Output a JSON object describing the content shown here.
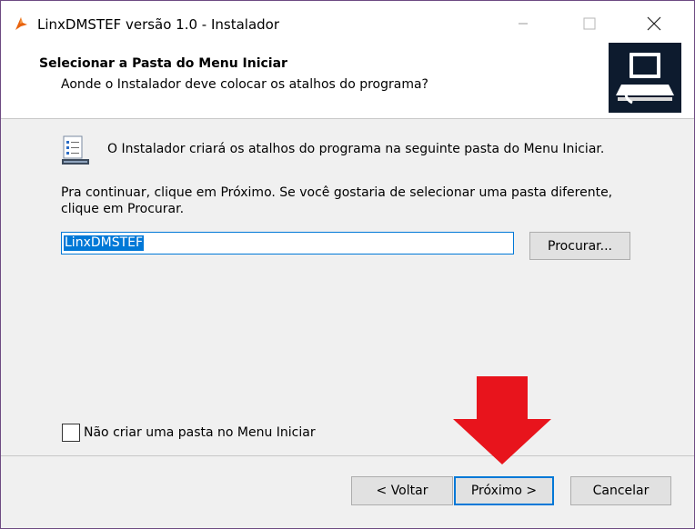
{
  "window": {
    "title": "LinxDMSTEF versão 1.0 - Instalador"
  },
  "header": {
    "title": "Selecionar a Pasta do Menu Iniciar",
    "subtitle": "Aonde o Instalador deve colocar os atalhos do programa?"
  },
  "content": {
    "info": "O Instalador criará os atalhos do programa na seguinte pasta do Menu Iniciar.",
    "instruction_line1": "Pra continuar, clique em Próximo. Se você gostaria de selecionar uma pasta diferente,",
    "instruction_line2": "clique em Procurar.",
    "folder_value": "LinxDMSTEF",
    "browse_label": "Procurar...",
    "no_folder_label": "Não criar uma pasta no Menu Iniciar",
    "no_folder_checked": false
  },
  "footer": {
    "back_label": "< Voltar",
    "next_label": "Próximo >",
    "cancel_label": "Cancelar"
  },
  "colors": {
    "accent": "#0078d7",
    "annotation_arrow": "#e8141c",
    "desktop": "#5a2d6e"
  },
  "icons": {
    "app": "installer-icon",
    "start_menu": "start-menu-shortcut-icon",
    "header_image": "computer-install-icon"
  }
}
